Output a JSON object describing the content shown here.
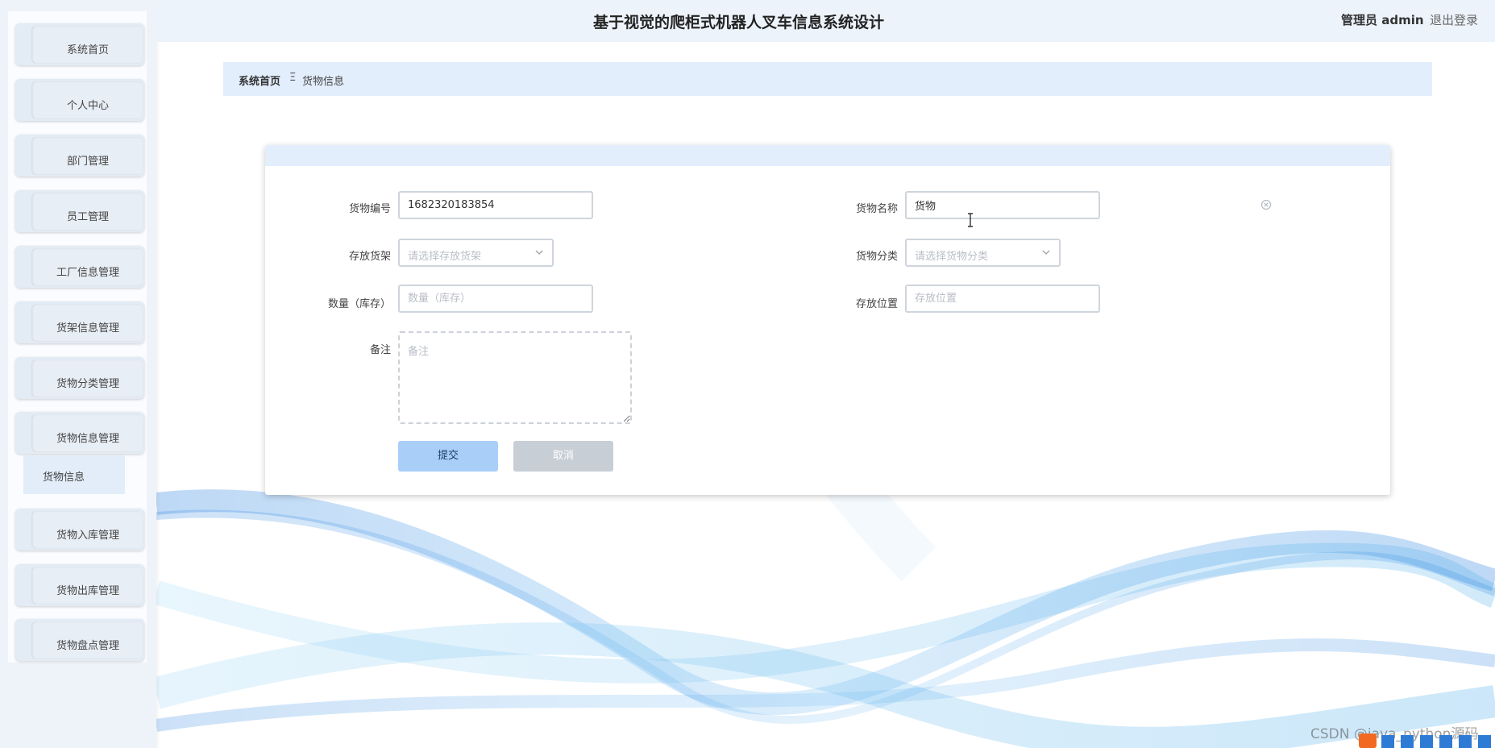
{
  "app": {
    "title": "基于视觉的爬柜式机器人叉车信息系统设计",
    "user_role": "管理员 admin",
    "logout_label": "退出登录"
  },
  "sidebar": {
    "items": [
      {
        "label": "系统首页"
      },
      {
        "label": "个人中心"
      },
      {
        "label": "部门管理"
      },
      {
        "label": "员工管理"
      },
      {
        "label": "工厂信息管理"
      },
      {
        "label": "货架信息管理"
      },
      {
        "label": "货物分类管理"
      },
      {
        "label": "货物信息管理"
      },
      {
        "label": "货物入库管理"
      },
      {
        "label": "货物出库管理"
      },
      {
        "label": "货物盘点管理"
      }
    ],
    "active_sub_item": "货物信息"
  },
  "breadcrumb": {
    "home": "系统首页",
    "separator": "Ξ",
    "current": "货物信息"
  },
  "form": {
    "goods_no": {
      "label": "货物编号",
      "value": "1682320183854"
    },
    "goods_name": {
      "label": "货物名称",
      "value": "货物"
    },
    "shelf": {
      "label": "存放货架",
      "placeholder": "请选择存放货架"
    },
    "category": {
      "label": "货物分类",
      "placeholder": "请选择货物分类"
    },
    "quantity": {
      "label": "数量（库存）",
      "placeholder": "数量（库存）"
    },
    "location": {
      "label": "存放位置",
      "placeholder": "存放位置"
    },
    "remark": {
      "label": "备注",
      "placeholder": "备注"
    },
    "submit_label": "提交",
    "cancel_label": "取消"
  },
  "watermark": "CSDN @java_python源码",
  "colors": {
    "accent": "#a9cff9",
    "header_bg": "#edf3fb",
    "breadcrumb_bg": "#e2eefc",
    "wave": "#3a8ee6"
  }
}
